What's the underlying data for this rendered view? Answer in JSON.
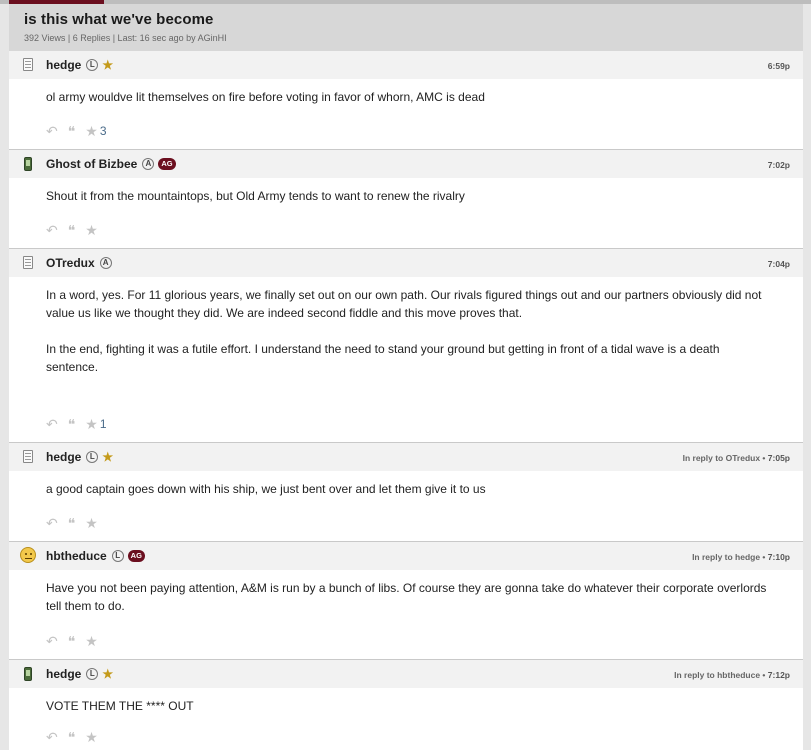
{
  "thread": {
    "title": "is this what we've become",
    "meta": "392 Views | 6 Replies | Last: 16 sec ago by AGinHI"
  },
  "colors": {
    "accent": "#6b0f1f",
    "star": "#c49a1a",
    "count": "#4b6c8a"
  },
  "posts": [
    {
      "user": "hedge",
      "badge": "L",
      "star": true,
      "ag": false,
      "device": "doc-icon",
      "time": "6:59p",
      "reply_to": "",
      "body": [
        "ol army wouldve lit themselves on fire before voting in favor of whorn, AMC is dead"
      ],
      "stars": "3"
    },
    {
      "user": "Ghost of Bizbee",
      "badge": "A",
      "star": false,
      "ag": true,
      "device": "phone-icon",
      "time": "7:02p",
      "reply_to": "",
      "body": [
        "Shout it from the mountaintops, but Old Army tends to want to renew the rivalry"
      ],
      "stars": ""
    },
    {
      "user": "OTredux",
      "badge": "A",
      "star": false,
      "ag": false,
      "device": "doc-icon",
      "time": "7:04p",
      "reply_to": "",
      "body": [
        "In a word, yes. For 11 glorious years, we finally set out on our own path. Our rivals figured things out and our partners obviously did not value us like we thought they did. We are indeed second fiddle and this move proves that.",
        "In the end, fighting it was a futile effort. I understand the need to stand your ground but getting in front of a tidal wave is a death sentence."
      ],
      "stars": "1"
    },
    {
      "user": "hedge",
      "badge": "L",
      "star": true,
      "ag": false,
      "device": "doc-icon",
      "time": "7:05p",
      "reply_to": "In reply to OTredux • ",
      "body": [
        "a good captain goes down with his ship, we just bent over and let them give it to us"
      ],
      "stars": ""
    },
    {
      "user": "hbtheduce",
      "badge": "L",
      "star": false,
      "ag": true,
      "device": "face-icon",
      "time": "7:10p",
      "reply_to": "In reply to hedge • ",
      "body": [
        "Have you not been paying attention, A&M is run by a bunch of libs. Of course they are gonna take do whatever their corporate overlords tell them to do."
      ],
      "stars": ""
    },
    {
      "user": "hedge",
      "badge": "L",
      "star": true,
      "ag": false,
      "device": "phone-icon",
      "time": "7:12p",
      "reply_to": "In reply to hbtheduce • ",
      "body": [
        "VOTE THEM THE **** OUT"
      ],
      "stars": ""
    }
  ],
  "labels": {
    "ag_badge": "AG",
    "star_glyph": "★",
    "reply_glyph": "↶",
    "quote_glyph": "❝",
    "rate_glyph": "★"
  }
}
